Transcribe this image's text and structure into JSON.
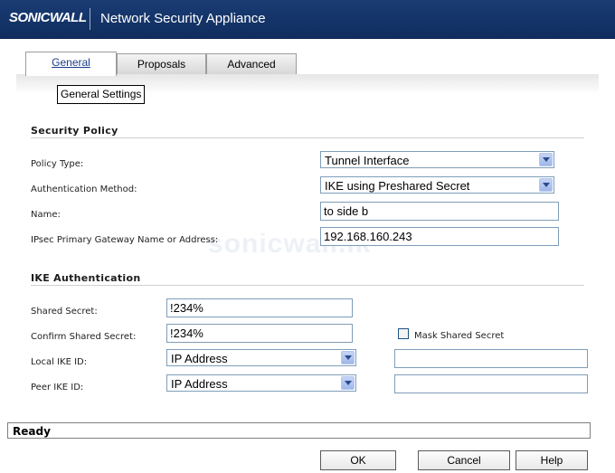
{
  "header": {
    "logo": "SONICWALL",
    "title": "Network Security Appliance"
  },
  "tabs": [
    {
      "label": "General",
      "active": true
    },
    {
      "label": "Proposals",
      "active": false
    },
    {
      "label": "Advanced",
      "active": false
    }
  ],
  "tooltip": "General Settings",
  "watermark": "sonicwall.lk",
  "security_policy": {
    "title": "Security Policy",
    "policy_type": {
      "label": "Policy Type:",
      "value": "Tunnel Interface"
    },
    "auth_method": {
      "label": "Authentication Method:",
      "value": "IKE using Preshared Secret"
    },
    "name": {
      "label": "Name:",
      "value": "to side b"
    },
    "gateway": {
      "label": "IPsec Primary Gateway Name or Address:",
      "value": "192.168.160.243"
    }
  },
  "ike_auth": {
    "title": "IKE Authentication",
    "shared_secret": {
      "label": "Shared Secret:",
      "value": "!234%"
    },
    "confirm_secret": {
      "label": "Confirm Shared Secret:",
      "value": "!234%"
    },
    "mask_secret": {
      "label": "Mask Shared Secret",
      "checked": false
    },
    "local_ike_id": {
      "label": "Local IKE ID:",
      "type": "IP Address",
      "value": ""
    },
    "peer_ike_id": {
      "label": "Peer IKE ID:",
      "type": "IP Address",
      "value": ""
    }
  },
  "status": "Ready",
  "buttons": {
    "ok": "OK",
    "cancel": "Cancel",
    "help": "Help"
  },
  "colors": {
    "header": "#1a3c74",
    "active_tab_text": "#1c3d8c",
    "input_border": "#7f9db9"
  }
}
